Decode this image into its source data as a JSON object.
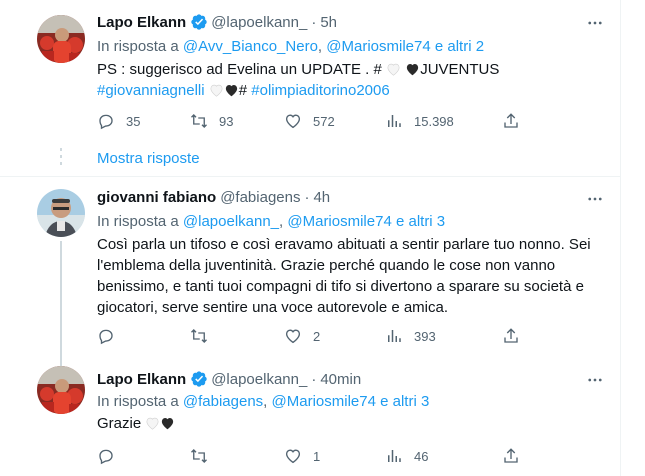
{
  "tweets": [
    {
      "name": "Lapo Elkann",
      "handle": "@lapoelkann_",
      "separator": "·",
      "time": "5h",
      "reply_prefix": "In risposta a",
      "reply_to": [
        "@Avv_Bianco_Nero",
        "@Mariosmile74 e altri 2"
      ],
      "text_plain_1": "PS : suggerisco ad Evelina un UPDATE . #",
      "text_plain_2": "JUVENTUS",
      "hashtag_1": "#giovanniagnelli",
      "hashtag_mid": "#",
      "hashtag_2": "#olimpiaditorino2006",
      "stats": {
        "replies": "35",
        "retweets": "93",
        "likes": "572",
        "views": "15.398"
      }
    },
    {
      "name": "giovanni fabiano",
      "handle": "@fabiagens",
      "separator": "·",
      "time": "4h",
      "reply_prefix": "In risposta a",
      "reply_to": [
        "@lapoelkann_",
        "@Mariosmile74 e altri 3"
      ],
      "text_lines": [
        "Così parla un tifoso e così eravamo abituati a sentir parlare tuo nonno. Sei",
        "l'emblema della juventinità. Grazie perché quando le cose non vanno",
        "benissimo, e tanti tuoi compagni di tifo si divertono a sparare su società e",
        "giocatori, serve sentire una voce autorevole e amica."
      ],
      "stats": {
        "replies": "",
        "retweets": "",
        "likes": "2",
        "views": "393"
      }
    },
    {
      "name": "Lapo Elkann",
      "handle": "@lapoelkann_",
      "separator": "·",
      "time": "40min",
      "reply_prefix": "In risposta a",
      "reply_to": [
        "@fabiagens",
        "@Mariosmile74 e altri 3"
      ],
      "text": "Grazie",
      "stats": {
        "replies": "",
        "retweets": "",
        "likes": "1",
        "views": "46"
      }
    }
  ],
  "show_replies": "Mostra risposte",
  "colors": {
    "accent": "#1d9bf0",
    "muted": "#536471",
    "text": "#0f1419",
    "verified": "#1d9bf0"
  },
  "icons": [
    "verified-badge-icon",
    "more-icon",
    "reply-icon",
    "retweet-icon",
    "like-icon",
    "views-icon",
    "share-icon",
    "white-heart-icon",
    "black-heart-icon"
  ]
}
